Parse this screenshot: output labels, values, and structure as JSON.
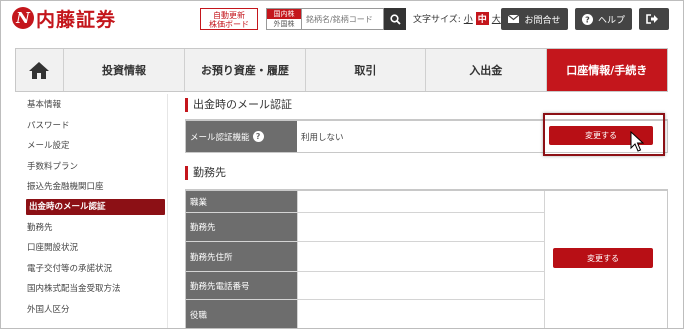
{
  "header": {
    "logo_mark": "N",
    "logo_text": "内藤証券",
    "auto_update_line1": "自動更新",
    "auto_update_line2": "株価ボード",
    "market_selected": "国内株",
    "market_other": "外国株",
    "search_placeholder": "銘柄名/銘柄コード",
    "font_size_label": "文字サイズ:",
    "font_sizes": [
      "小",
      "中",
      "大"
    ],
    "contact_label": "お問合せ",
    "help_label": "ヘルプ"
  },
  "nav": {
    "items": [
      "投資情報",
      "お預り資産・履歴",
      "取引",
      "入出金",
      "口座情報/手続き"
    ]
  },
  "sidebar": {
    "items": [
      "基本情報",
      "パスワード",
      "メール設定",
      "手数料プラン",
      "振込先金融機関口座",
      "出金時のメール認証",
      "勤務先",
      "口座開設状況",
      "電子交付等の承諾状況",
      "国内株式配当金受取方法",
      "外国人区分"
    ]
  },
  "section1": {
    "title": "出金時のメール認証",
    "row_label": "メール認証機能",
    "help_mark": "?",
    "row_value": "利用しない",
    "button": "変更する"
  },
  "section2": {
    "title": "勤務先",
    "rows": [
      "職業",
      "勤務先",
      "勤務先住所",
      "勤務先電話番号",
      "役職"
    ],
    "button": "変更する"
  }
}
